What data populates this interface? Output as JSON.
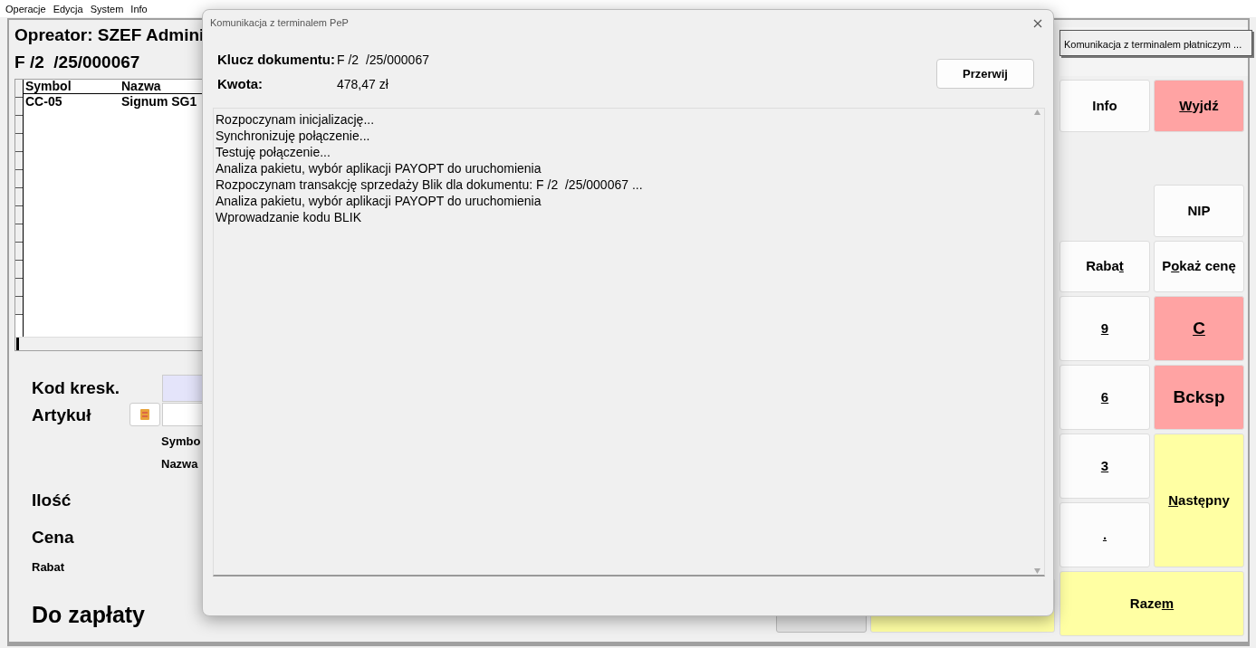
{
  "menu": [
    "Operacje",
    "Edycja",
    "System",
    "Info"
  ],
  "operator": "Opreator: SZEF Admini",
  "document": "F /2  /25/000067",
  "table": {
    "columns": [
      "Symbol",
      "Nazwa"
    ],
    "rows": [
      [
        "CC-05",
        "Signum SG1"
      ]
    ]
  },
  "form": {
    "barcode_label": "Kod kresk.",
    "article_label": "Artykuł",
    "symbol_label": "Symbo",
    "name_label": "Nazwa",
    "quantity_label": "Ilość",
    "price_label": "Cena",
    "discount_label": "Rabat",
    "total_label": "Do zapłaty"
  },
  "terminal_tab": "Komunikacja z terminalem płatniczym ...",
  "keys": [
    {
      "color": "#fcfcfc",
      "parts": [
        {
          "text": "Info",
          "underline": false
        }
      ]
    },
    {
      "color": "#ffa3a3",
      "parts": [
        {
          "text": "W",
          "underline": true
        },
        {
          "text": "yjdź",
          "underline": false
        }
      ]
    },
    {
      "color": "#fcfcfc",
      "parts": [
        {
          "text": "NIP",
          "underline": false
        }
      ]
    },
    {
      "color": "#fcfcfc",
      "parts": [
        {
          "text": "Raba",
          "underline": false
        },
        {
          "text": "t",
          "underline": true
        }
      ]
    },
    {
      "color": "#fcfcfc",
      "parts": [
        {
          "text": "P",
          "underline": false
        },
        {
          "text": "o",
          "underline": true
        },
        {
          "text": "każ cenę",
          "underline": false
        }
      ]
    },
    {
      "color": "#fcfcfc",
      "parts": [
        {
          "text": "9",
          "underline": true
        }
      ]
    },
    {
      "color": "#ffa3a3",
      "parts": [
        {
          "text": "C",
          "underline": true
        }
      ]
    },
    {
      "color": "#fcfcfc",
      "parts": [
        {
          "text": "6",
          "underline": true
        }
      ]
    },
    {
      "color": "#ffa3a3",
      "parts": [
        {
          "text": "Bcksp",
          "underline": false
        }
      ]
    },
    {
      "color": "#fcfcfc",
      "parts": [
        {
          "text": "3",
          "underline": true
        }
      ]
    },
    {
      "color": "#ffffa3",
      "parts": [
        {
          "text": "N",
          "underline": true
        },
        {
          "text": "astępny",
          "underline": false
        }
      ]
    },
    {
      "color": "#fcfcfc",
      "parts": [
        {
          "text": ".",
          "underline": true
        }
      ]
    },
    {
      "color": "#ffffa3",
      "parts": [
        {
          "text": "Raze",
          "underline": false
        },
        {
          "text": "m",
          "underline": true
        }
      ]
    }
  ],
  "dialog": {
    "title": "Komunikacja z terminalem PeP",
    "key_label": "Klucz dokumentu:",
    "key_value": "F /2  /25/000067",
    "amount_label": "Kwota:",
    "amount_value": "478,47 zł",
    "abort_button": "Przerwij",
    "log": [
      "Rozpoczynam inicjalizację...",
      "Synchronizuję połączenie...",
      "Testuję połączenie...",
      "Analiza pakietu, wybór aplikacji PAYOPT do uruchomienia",
      "Rozpoczynam transakcję sprzedaży Blik dla dokumentu: F /2  /25/000067 ...",
      "Analiza pakietu, wybór aplikacji PAYOPT do uruchomienia",
      "Wprowadzanie kodu BLIK"
    ]
  }
}
